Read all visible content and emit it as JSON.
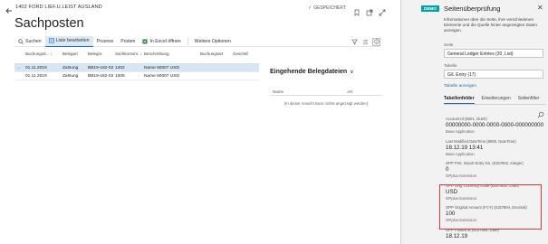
{
  "header": {
    "breadcrumb": "1402 FORD LIEF.U.LEIST AUSLAND",
    "saved": "GESPEICHERT",
    "saved_check": "✓"
  },
  "page": {
    "title": "Sachposten"
  },
  "actions": {
    "search": "Suchen",
    "edit_list": "Liste bearbeiten",
    "process": "Prozess",
    "entries": "Posten",
    "excel": "In Excel öffnen",
    "more": "Weitere Optionen"
  },
  "table": {
    "headers": [
      "Buchungsd... ↓",
      "Belegart",
      "Belegnr.",
      "Sachkontonr. ↓",
      "Beschreibung",
      "Buchungsart",
      "Geschäf"
    ],
    "rows": [
      {
        "marker": "→",
        "date": "01.11.2019",
        "doc_type": "Zahlung",
        "doc_no": "BB19-182-023",
        "account": "1402",
        "description": "Name 50007 USD",
        "posting_type": "",
        "business": ""
      },
      {
        "marker": "",
        "date": "01.11.2019",
        "doc_type": "Zahlung",
        "doc_no": "BB19-182-023",
        "account": "1005",
        "description": "Name 50007 USD",
        "posting_type": "",
        "business": ""
      }
    ]
  },
  "incoming_docs": {
    "title": "Eingehende Belegdateien",
    "chevron": "∨",
    "col_name": "Name",
    "col_type": "Art",
    "empty": "(In dieser Ansicht kann nichts angezeigt werden)"
  },
  "inspector": {
    "badge": "DEMO",
    "title": "Seitenüberprüfung",
    "close": "✕",
    "description": "Informationen über die Seite, ihre verschiedenen Elemente und die Quelle hinter angezeigten Daten anzeigen.",
    "page_label": "Seite",
    "page_value": "General Ledger Entries (20, List)",
    "table_label": "Tabelle",
    "table_value": "G/L Entry (17)",
    "show_table": "Tabelle anzeigen",
    "tabs": [
      "Tabellenfelder",
      "Erweiterungen",
      "Seitenfilter"
    ],
    "fields": [
      {
        "name": "Account Id (8001, GUID)",
        "value": "00000000-0000-0000-0000-000000000000",
        "source": "Base Application"
      },
      {
        "name": "Last Modified DateTime (8005, DateTime)",
        "value": "18.12.19 13:41",
        "source": "Base Application"
      },
      {
        "name": "OPP Pmt. Import Entry No. (5157802, Integer)",
        "value": "0",
        "source": "OPplus Extension"
      },
      {
        "name": "OPP Orig. Currency Code (5157803, Code)",
        "value": "USD",
        "source": "OPplus Extension"
      },
      {
        "name": "OPP Original Amount (FCY) (5157804, Decimal)",
        "value": "100",
        "source": "OPplus Extension"
      },
      {
        "name": "OPP Posted at (5157805, Date)",
        "value": "18.12.19",
        "source": ""
      }
    ]
  },
  "colors": {
    "accent": "#1f6fb5",
    "highlight": "#d9363e",
    "badge": "#00a4a6",
    "selected_row": "#d7e6f6"
  }
}
